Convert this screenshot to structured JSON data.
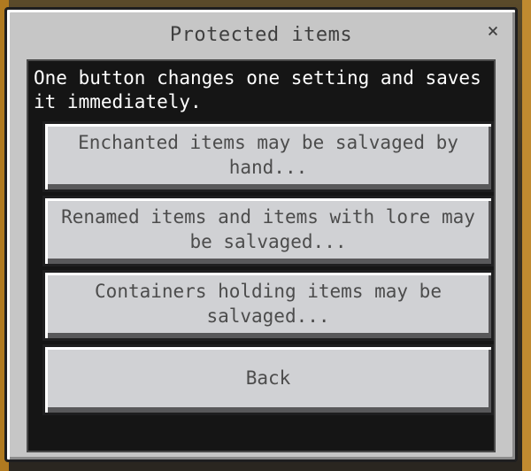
{
  "dialog": {
    "title": "Protected items",
    "close_symbol": "×",
    "description": "One button changes one setting and saves it immediately.",
    "buttons": [
      {
        "label": "Enchanted items may be salvaged by hand..."
      },
      {
        "label": "Renamed items and items with lore may be salvaged..."
      },
      {
        "label": "Containers holding items may be salvaged..."
      },
      {
        "label": "Back"
      }
    ]
  },
  "colors": {
    "panel": "#c6c6c6",
    "content_bg": "#151515",
    "button_face": "#d0d1d4",
    "text_dark": "#3f3f3f",
    "text_light": "#ffffff"
  },
  "icons": {
    "close": "close-icon"
  }
}
